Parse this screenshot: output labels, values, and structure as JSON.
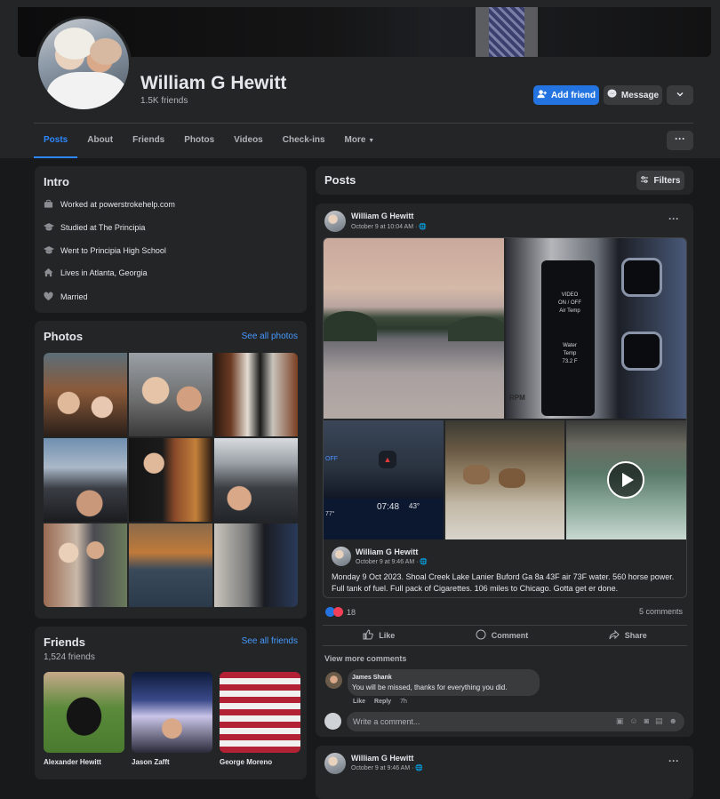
{
  "profile": {
    "name": "William G Hewitt",
    "friends_count": "1.5K friends",
    "add_friend_label": "Add friend",
    "message_label": "Message"
  },
  "tabs": [
    {
      "label": "Posts",
      "active": true
    },
    {
      "label": "About"
    },
    {
      "label": "Friends"
    },
    {
      "label": "Photos"
    },
    {
      "label": "Videos"
    },
    {
      "label": "Check-ins"
    },
    {
      "label": "More"
    }
  ],
  "intro": {
    "title": "Intro",
    "items": [
      {
        "icon": "briefcase-icon",
        "text": "Worked at powerstrokehelp.com"
      },
      {
        "icon": "graduation-cap-icon",
        "text": "Studied at The Principia"
      },
      {
        "icon": "graduation-cap-icon",
        "text": "Went to Principia High School"
      },
      {
        "icon": "home-icon",
        "text": "Lives in Atlanta, Georgia"
      },
      {
        "icon": "heart-icon",
        "text": "Married"
      }
    ]
  },
  "photos": {
    "title": "Photos",
    "see_all": "See all photos"
  },
  "friends": {
    "title": "Friends",
    "count": "1,524 friends",
    "see_all": "See all friends",
    "items": [
      {
        "name": "Alexander Hewitt"
      },
      {
        "name": "Jason Zafft"
      },
      {
        "name": "George Moreno"
      }
    ]
  },
  "posts_section": {
    "title": "Posts",
    "filters_label": "Filters"
  },
  "post": {
    "author": "William G Hewitt",
    "meta": "October 9 at 10:04 AM · ",
    "shared_author": "William G Hewitt",
    "shared_meta": "October 9 at 9:46 AM · ",
    "text": "Monday 9 Oct 2023. Shoal Creek Lake Lanier Buford Ga 8a 43F air 73F water. 560 horse power. Full tank of fuel. Full pack of Cigarettes. 106 miles to Chicago. Gotta get er done.",
    "reaction_count": "18",
    "comments_count": "5 comments",
    "like_label": "Like",
    "comment_label": "Comment",
    "share_label": "Share",
    "view_more": "View more comments",
    "dash": {
      "video_label": "VIDEO",
      "onoff_label": "ON / OFF",
      "air_temp": "Air Temp",
      "water_label": "Water",
      "temp_label": "Temp",
      "water_temp": "73.2 F",
      "rpm_label": "RPM",
      "car_time": "07:48",
      "car_temp": "43°",
      "car_temp2": "77°",
      "off_label": "OFF"
    },
    "comment": {
      "author": "James Shank",
      "text": "You will be missed, thanks for everything you did.",
      "like": "Like",
      "reply": "Reply",
      "time": "7h"
    },
    "input_placeholder": "Write a comment..."
  },
  "post2": {
    "author": "William G Hewitt",
    "meta": "October 9 at 9:46 AM · "
  },
  "colors": {
    "accent": "#2374e1",
    "link": "#4599ff",
    "card": "#242526",
    "background": "#18191a"
  }
}
